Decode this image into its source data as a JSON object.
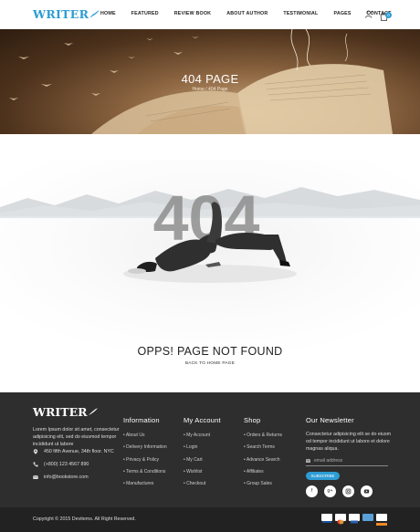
{
  "header": {
    "logo": "WRITER",
    "nav": [
      "HOME",
      "FEATURED",
      "REVIEW BOOK",
      "ABOUT AUTHOR",
      "TESTIMONIAL",
      "PAGES",
      "CONTACT"
    ],
    "cart_count": "0"
  },
  "banner": {
    "title": "404 PAGE",
    "breadcrumb": "Home / 404 Page"
  },
  "error": {
    "big_number": "404",
    "title": "OPPS! PAGE NOT FOUND",
    "link": "BACK TO HOME PAGE"
  },
  "footer": {
    "logo": "WRITER",
    "about": "Lorem Ipsum dolor sit amet, consectetur adipisicing elit, sed do eiusmod tempor incididunt ut labore",
    "address": "450 fifth Avenue, 34th floor. NYC",
    "phone": "(+800) 123 4567 890",
    "email": "info@bookstore.com",
    "columns": [
      {
        "title": "Information",
        "items": [
          "About Us",
          "Delivery Information",
          "Privacy & Policy",
          "Terms & Conditions",
          "Manufactures"
        ]
      },
      {
        "title": "My Account",
        "items": [
          "My Account",
          "Login",
          "My Cart",
          "Wishlist",
          "Checkout"
        ]
      },
      {
        "title": "Shop",
        "items": [
          "Orders & Returns",
          "Search Terms",
          "Advance Search",
          "Affiliates",
          "Group Sales"
        ]
      }
    ],
    "newsletter": {
      "title": "Our Newsletter",
      "text": "Consectetur adipisicing elit se do eiusm od tempor incididunt ut labore et dolore magnas aliqua.",
      "placeholder": "email address",
      "button": "SUBSCRIBE"
    },
    "social_icons": [
      "facebook-icon",
      "google-plus-icon",
      "instagram-icon",
      "youtube-icon"
    ],
    "copyright": "Copyright © 2015 Devitems. All Right Reserved.",
    "payment_icons": [
      "visa-icon",
      "mastercard-icon",
      "paypal-icon",
      "amex-icon",
      "discover-icon"
    ],
    "payment_colors": [
      "#1a4f9c",
      "#e8a13a",
      "#2b5fb0",
      "#5aa0d8",
      "#f08a24"
    ]
  },
  "colors": {
    "accent": "#2d9cd3",
    "footer_bg": "#2e2e2e",
    "footer_bottom": "#222222"
  }
}
